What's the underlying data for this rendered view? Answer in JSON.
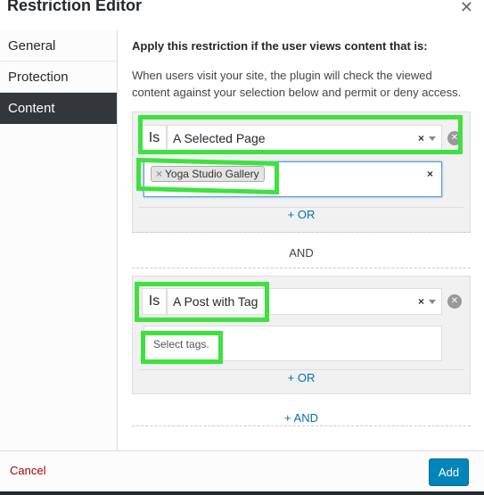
{
  "modal": {
    "title": "Restriction Editor",
    "close_icon": "close-icon"
  },
  "sidebar": {
    "items": [
      {
        "label": "General",
        "active": false
      },
      {
        "label": "Protection",
        "active": false
      },
      {
        "label": "Content",
        "active": true
      }
    ]
  },
  "content": {
    "heading": "Apply this restriction if the user views content that is:",
    "description": "When users visit your site, the plugin will check the viewed content against your selection below and permit or deny access.",
    "groups": [
      {
        "operator": "Is",
        "selected": "A Selected Page",
        "clear_symbol": "×",
        "chips": [
          "Yoga Studio Gallery"
        ],
        "chip_remove_symbol": "×",
        "multi_clear_symbol": "×",
        "or_label": "+ OR"
      },
      {
        "operator": "Is",
        "selected": "A Post with Tag",
        "clear_symbol": "×",
        "placeholder": "Select tags.",
        "or_label": "+ OR"
      }
    ],
    "and_label": "AND",
    "add_and_label": "+ AND"
  },
  "footer": {
    "cancel_label": "Cancel",
    "add_label": "Add"
  },
  "colors": {
    "highlight": "#3ee23e",
    "primary_button": "#0085ba",
    "link": "#0073aa",
    "cancel": "#a00000",
    "sidebar_active": "#32373c"
  }
}
